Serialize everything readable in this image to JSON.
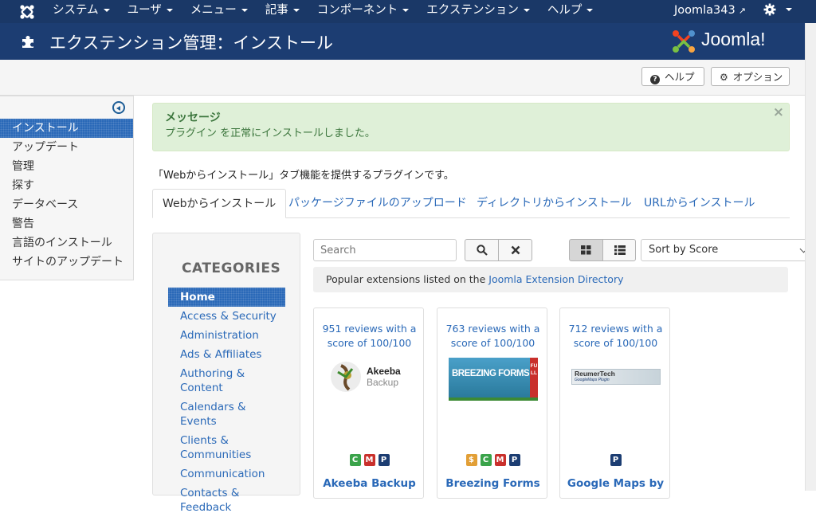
{
  "navbar": {
    "menu": [
      "システム",
      "ユーザ",
      "メニュー",
      "記事",
      "コンポーネント",
      "エクステンション",
      "ヘルプ"
    ],
    "user": "Joomla343"
  },
  "header": {
    "title": "エクステンション管理：インストール",
    "logo_text": "Joomla!"
  },
  "toolbar": {
    "help_label": "ヘルプ",
    "options_label": "オプション"
  },
  "sidebar": {
    "items": [
      "インストール",
      "アップデート",
      "管理",
      "探す",
      "データベース",
      "警告",
      "言語のインストール",
      "サイトのアップデート"
    ],
    "active_index": 0
  },
  "alert": {
    "heading": "メッセージ",
    "message": "プラグイン を正常にインストールしました。",
    "close": "×"
  },
  "description": "「Webからインストール」タブ機能を提供するプラグインです。",
  "tabs": [
    "Webからインストール",
    "パッケージファイルのアップロード",
    "ディレクトリからインストール",
    "URLからインストール"
  ],
  "categories": {
    "heading": "CATEGORIES",
    "items": [
      "Home",
      "Access & Security",
      "Administration",
      "Ads & Affiliates",
      "Authoring & Content",
      "Calendars & Events",
      "Clients & Communities",
      "Communication",
      "Contacts & Feedback"
    ],
    "active_index": 0
  },
  "search": {
    "placeholder": "Search",
    "sort_value": "Sort by Score"
  },
  "popular": {
    "prefix": "Popular extensions listed on the ",
    "link": "Joomla Extension Directory"
  },
  "cards": [
    {
      "reviews": "951 reviews with a score of 100/100",
      "name": "Akeeba Backup",
      "logo_text": [
        "Akeeba",
        "Backup"
      ],
      "badges": [
        "C",
        "M",
        "P"
      ]
    },
    {
      "reviews": "763 reviews with a score of 100/100",
      "name": "Breezing Forms",
      "logo_text": [
        "BREEZING FORMS",
        "FULL"
      ],
      "badges": [
        "$",
        "C",
        "M",
        "P"
      ]
    },
    {
      "reviews": "712 reviews with a score of 100/100",
      "name": "Google Maps by",
      "logo_text": [
        "ReumerTech",
        "GoogleMaps Plugin"
      ],
      "badges": [
        "P"
      ]
    }
  ],
  "colors": {
    "navbar": "#1a3867",
    "header": "#1c3d72",
    "link": "#2a69b8",
    "alert_bg": "#dff0d8",
    "alert_text": "#3c763d",
    "badge_c": "#3aa34a",
    "badge_m": "#c9302c",
    "badge_p": "#1c3d72",
    "badge_s": "#e29f36"
  },
  "icons": {
    "navbar_logo": "joomla-logo-icon",
    "user_link": "external-link-icon",
    "settings": "gear-icon",
    "header": "puzzle-icon",
    "help_btn": "question-circle-icon",
    "options_btn": "gear-icon",
    "sidebar_toggle": "arrow-left-circle-icon",
    "search_btn": "search-icon",
    "clear_btn": "close-icon",
    "grid_view": "grid-icon",
    "list_view": "list-icon"
  }
}
